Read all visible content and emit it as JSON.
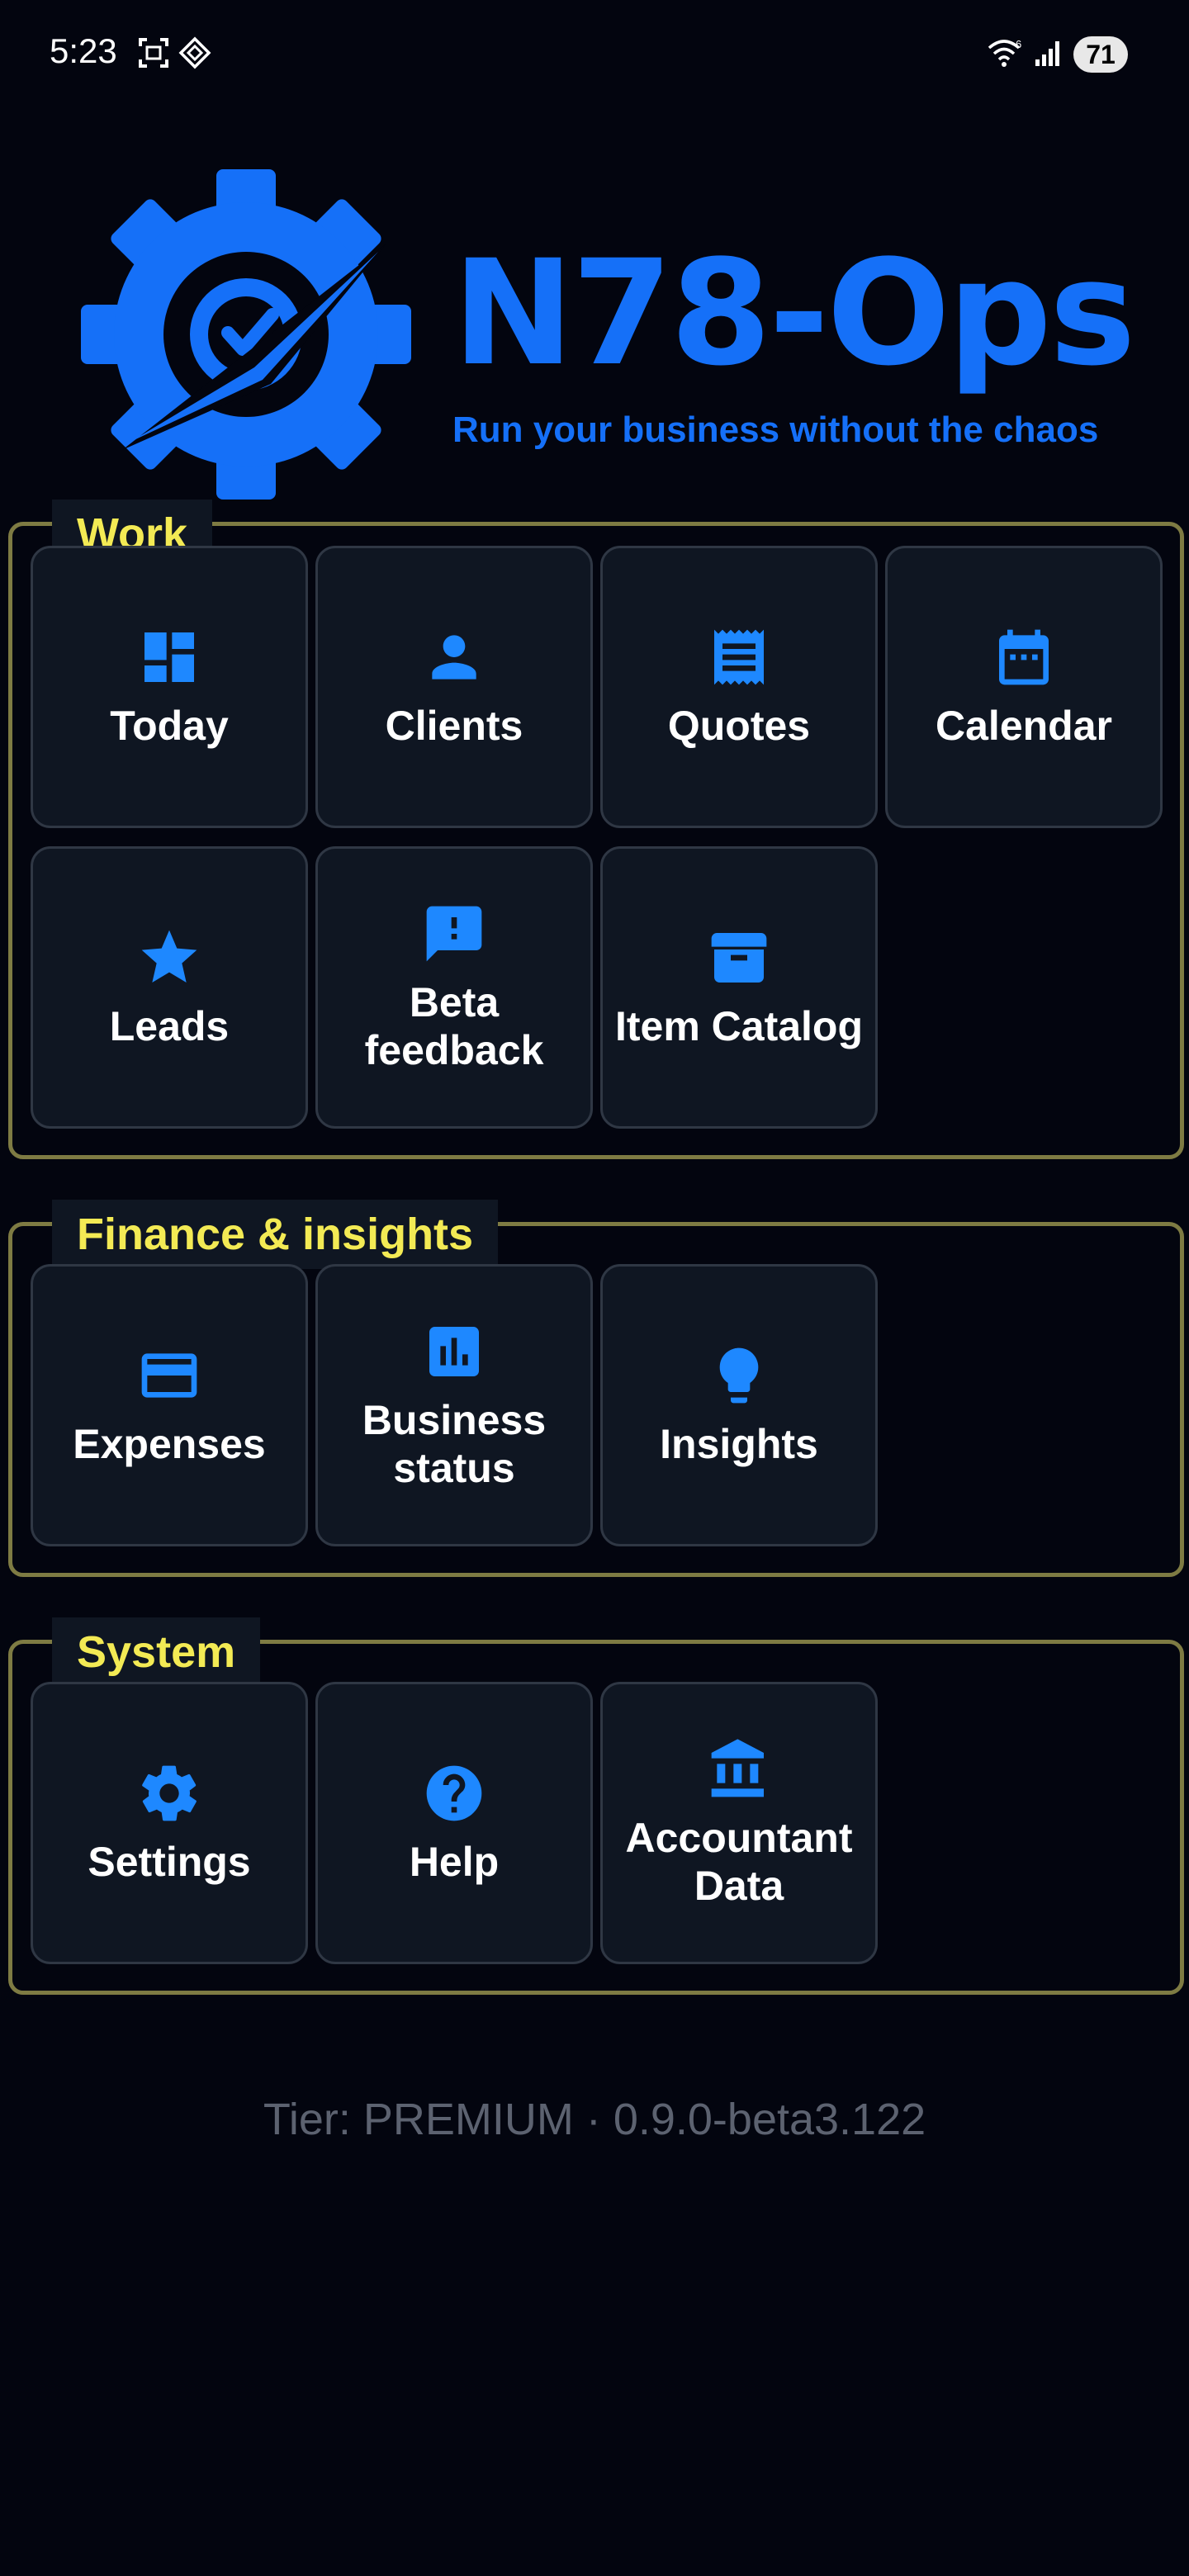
{
  "status_bar": {
    "time": "5:23",
    "battery": "71",
    "icons": [
      "screenshot-icon",
      "diamond-icon",
      "wifi-icon",
      "signal-icon",
      "battery-icon"
    ]
  },
  "brand": {
    "title": "N78-Ops",
    "tagline": "Run your business without the chaos",
    "accent_color": "#1570f8",
    "label_color": "#f3ea54"
  },
  "sections": {
    "work": {
      "label": "Work",
      "items": [
        {
          "label": "Today",
          "icon": "dashboard-icon"
        },
        {
          "label": "Clients",
          "icon": "person-icon"
        },
        {
          "label": "Quotes",
          "icon": "receipt-icon"
        },
        {
          "label": "Calendar",
          "icon": "calendar-icon"
        },
        {
          "label": "Leads",
          "icon": "star-icon"
        },
        {
          "label": "Beta feedback",
          "icon": "feedback-icon"
        },
        {
          "label": "Item Catalog",
          "icon": "archive-icon"
        }
      ]
    },
    "finance": {
      "label": "Finance & insights",
      "items": [
        {
          "label": "Expenses",
          "icon": "credit-card-icon"
        },
        {
          "label": "Business status",
          "icon": "bar-chart-icon"
        },
        {
          "label": "Insights",
          "icon": "lightbulb-icon"
        }
      ]
    },
    "system": {
      "label": "System",
      "items": [
        {
          "label": "Settings",
          "icon": "gear-icon"
        },
        {
          "label": "Help",
          "icon": "help-icon"
        },
        {
          "label": "Accountant Data",
          "icon": "bank-icon"
        }
      ]
    }
  },
  "footer": {
    "text": "Tier: PREMIUM · 0.9.0-beta3.122"
  }
}
